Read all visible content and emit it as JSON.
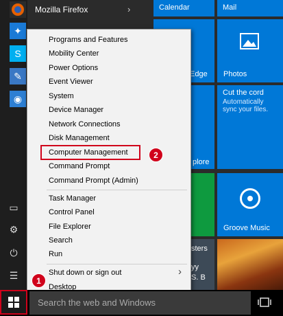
{
  "applist": [
    {
      "name": "Mozilla Firefox",
      "icon": "firefox-icon",
      "color": "#e66000"
    },
    {
      "name": "",
      "icon": "lightbulb-icon",
      "color": "#1a7ad6"
    },
    {
      "name": "",
      "icon": "skype-icon",
      "color": "#00aff0"
    },
    {
      "name": "",
      "icon": "paint-icon",
      "color": "#3a78c4"
    },
    {
      "name": "",
      "icon": "webcam-icon",
      "color": "#2d7fd3"
    }
  ],
  "tiles": {
    "calendar": "Calendar",
    "mail": "Mail",
    "edge": "Edge",
    "photos": "Photos",
    "cut_title": "Cut the cord",
    "cut_sub": "Automatically sync your files.",
    "explore": "plore",
    "groove": "Groove Music",
    "news1": "sters",
    "news2": "yy",
    "news3": "S. B"
  },
  "context_menu": {
    "group1": [
      "Programs and Features",
      "Mobility Center",
      "Power Options",
      "Event Viewer",
      "System",
      "Device Manager",
      "Network Connections",
      "Disk Management",
      "Computer Management",
      "Command Prompt",
      "Command Prompt (Admin)"
    ],
    "group2": [
      "Task Manager",
      "Control Panel",
      "File Explorer",
      "Search",
      "Run"
    ],
    "group3": [
      "Shut down or sign out",
      "Desktop"
    ],
    "submenu_arrow": "›"
  },
  "badges": {
    "one": "1",
    "two": "2"
  },
  "taskbar": {
    "search_placeholder": "Search the web and Windows"
  },
  "colors": {
    "tile_blue": "#0078d7",
    "annotation_red": "#d0021b"
  }
}
